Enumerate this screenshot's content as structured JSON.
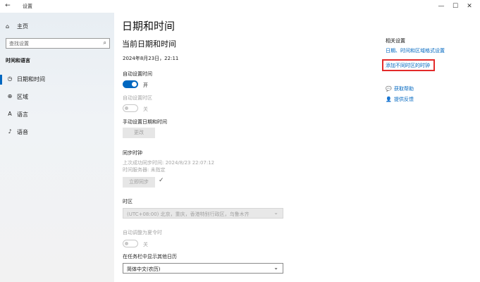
{
  "window": {
    "title": "设置",
    "back_icon": "back-arrow-icon",
    "controls": [
      "minimize-icon",
      "maximize-icon",
      "close-icon"
    ]
  },
  "sidebar": {
    "home_label": "主页",
    "search_placeholder": "查找设置",
    "section_title": "时间和语言",
    "items": [
      {
        "label": "日期和时间",
        "icon": "clock-calendar-icon",
        "active": true
      },
      {
        "label": "区域",
        "icon": "globe-icon",
        "active": false
      },
      {
        "label": "语言",
        "icon": "language-icon",
        "active": false
      },
      {
        "label": "语音",
        "icon": "microphone-icon",
        "active": false
      }
    ]
  },
  "main": {
    "page_title": "日期和时间",
    "current_heading": "当前日期和时间",
    "current_datetime": "2024年8月23日，22:11",
    "auto_time": {
      "label": "自动设置时间",
      "state": "开"
    },
    "auto_timezone": {
      "label": "自动设置时区",
      "state": "关"
    },
    "manual": {
      "label": "手动设置日期和时间",
      "button": "更改"
    },
    "sync": {
      "title": "同步时钟",
      "last_sync": "上次成功同步时间: 2024/8/23 22:07:12",
      "server": "时间服务器: 未指定",
      "button": "立即同步"
    },
    "timezone": {
      "label": "时区",
      "value": "(UTC+08:00) 北京，重庆，香港特别行政区，乌鲁木齐"
    },
    "dst": {
      "label": "自动调整为夏令时",
      "state": "关"
    },
    "calendar": {
      "label": "在任务栏中显示其他日历",
      "value": "简体中文(农历)"
    }
  },
  "related": {
    "title": "相关设置",
    "links": [
      "日期、时间和区域格式设置",
      "添加不同时区的时钟"
    ],
    "help": {
      "label": "获取帮助",
      "icon": "help-chat-icon"
    },
    "feedback": {
      "label": "提供反馈",
      "icon": "feedback-icon"
    }
  },
  "colors": {
    "accent": "#0067c0",
    "highlight_border": "#e32a2a"
  }
}
